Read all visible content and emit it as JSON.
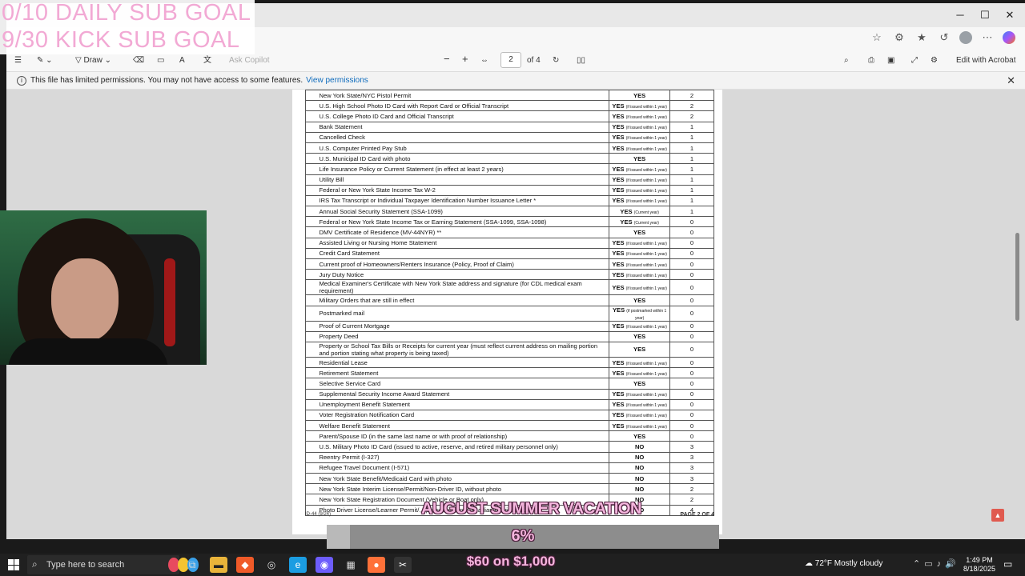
{
  "stream_goals": {
    "daily_sub_goal": "0/10 DAILY SUB GOAL",
    "kick_sub_goal": "9/30 KICK SUB GOAL"
  },
  "window_controls": {
    "minimize": "─",
    "maximize": "☐",
    "close": "✕"
  },
  "pdf_toolbar": {
    "draw_label": "Draw",
    "ask_copilot": "Ask Copilot",
    "zoom_out": "−",
    "zoom_in": "+",
    "current_page": "2",
    "page_total": "of 4",
    "edit_with_acrobat": "Edit with Acrobat"
  },
  "infobar": {
    "message": "This file has limited permissions. You may not have access to some features.",
    "link": "View permissions"
  },
  "document": {
    "rows": [
      {
        "name": "New York State/NYC Pistol Permit",
        "accept": "YES",
        "note": "",
        "points": "2"
      },
      {
        "name": "U.S. High School Photo ID Card with Report Card or Official Transcript",
        "accept": "YES",
        "note": "(if issued within 1 year)",
        "points": "2"
      },
      {
        "name": "U.S. College Photo ID Card and Official Transcript",
        "accept": "YES",
        "note": "(if issued within 1 year)",
        "points": "2"
      },
      {
        "name": "Bank Statement",
        "accept": "YES",
        "note": "(if issued within 1 year)",
        "points": "1"
      },
      {
        "name": "Cancelled Check",
        "accept": "YES",
        "note": "(if issued within 1 year)",
        "points": "1"
      },
      {
        "name": "U.S. Computer Printed Pay Stub",
        "accept": "YES",
        "note": "(if issued within 1 year)",
        "points": "1"
      },
      {
        "name": "U.S. Municipal ID Card with photo",
        "accept": "YES",
        "note": "",
        "points": "1"
      },
      {
        "name": "Life Insurance Policy or Current Statement (in effect at least 2 years)",
        "accept": "YES",
        "note": "(if issued within 1 year)",
        "points": "1"
      },
      {
        "name": "Utility Bill",
        "accept": "YES",
        "note": "(if issued within 1 year)",
        "points": "1"
      },
      {
        "name": "Federal or New York State Income Tax W-2",
        "accept": "YES",
        "note": "(if issued within 1 year)",
        "points": "1"
      },
      {
        "name": "IRS Tax Transcript or Individual Taxpayer Identification Number Issuance Letter *",
        "accept": "YES",
        "note": "(if issued within 1 year)",
        "points": "1"
      },
      {
        "name": "Annual Social Security Statement (SSA-1099)",
        "accept": "YES",
        "note": "(Current year)",
        "points": "1"
      },
      {
        "name": "Federal or New York State Income Tax or Earning Statement (SSA-1099, SSA-1098)",
        "accept": "YES",
        "note": "(Current year)",
        "points": "0"
      },
      {
        "name": "DMV Certificate of Residence (MV-44NYR) **",
        "accept": "YES",
        "note": "",
        "points": "0"
      },
      {
        "name": "Assisted Living or Nursing Home Statement",
        "accept": "YES",
        "note": "(if issued within 1 year)",
        "points": "0"
      },
      {
        "name": "Credit Card Statement",
        "accept": "YES",
        "note": "(if issued within 1 year)",
        "points": "0"
      },
      {
        "name": "Current proof of Homeowners/Renters Insurance (Policy, Proof of Claim)",
        "accept": "YES",
        "note": "(if issued within 1 year)",
        "points": "0"
      },
      {
        "name": "Jury Duty Notice",
        "accept": "YES",
        "note": "(if issued within 1 year)",
        "points": "0"
      },
      {
        "name": "Medical Examiner's Certificate with New York State address and signature (for CDL medical exam requirement)",
        "accept": "YES",
        "note": "(if issued within 1 year)",
        "points": "0"
      },
      {
        "name": "Military Orders that are still in effect",
        "accept": "YES",
        "note": "",
        "points": "0"
      },
      {
        "name": "Postmarked mail",
        "accept": "YES",
        "note": "(if postmarked within 1 year)",
        "points": "0"
      },
      {
        "name": "Proof of Current Mortgage",
        "accept": "YES",
        "note": "(if issued within 1 year)",
        "points": "0"
      },
      {
        "name": "Property Deed",
        "accept": "YES",
        "note": "",
        "points": "0"
      },
      {
        "name": "Property or School Tax Bills or Receipts for current year (must reflect current address on mailing portion and portion stating what property is being taxed)",
        "accept": "YES",
        "note": "",
        "points": "0"
      },
      {
        "name": "Residential Lease",
        "accept": "YES",
        "note": "(if issued within 1 year)",
        "points": "0"
      },
      {
        "name": "Retirement Statement",
        "accept": "YES",
        "note": "(if issued within 1 year)",
        "points": "0"
      },
      {
        "name": "Selective Service Card",
        "accept": "YES",
        "note": "",
        "points": "0"
      },
      {
        "name": "Supplemental Security Income Award Statement",
        "accept": "YES",
        "note": "(if issued within 1 year)",
        "points": "0"
      },
      {
        "name": "Unemployment Benefit Statement",
        "accept": "YES",
        "note": "(if issued within 1 year)",
        "points": "0"
      },
      {
        "name": "Voter Registration Notification Card",
        "accept": "YES",
        "note": "(if issued within 1 year)",
        "points": "0"
      },
      {
        "name": "Welfare Benefit Statement",
        "accept": "YES",
        "note": "(if issued within 1 year)",
        "points": "0"
      },
      {
        "name": "Parent/Spouse ID (in the same last name or with proof of relationship)",
        "accept": "YES",
        "note": "",
        "points": "0"
      },
      {
        "name": "U.S. Military Photo ID Card (issued to active, reserve, and retired military personnel only)",
        "accept": "NO",
        "note": "",
        "points": "3"
      },
      {
        "name": "Reentry Permit (I-327)",
        "accept": "NO",
        "note": "",
        "points": "3"
      },
      {
        "name": "Refugee Travel Document (I-571)",
        "accept": "NO",
        "note": "",
        "points": "3"
      },
      {
        "name": "New York State Benefit/Medicaid Card with photo",
        "accept": "NO",
        "note": "",
        "points": "3"
      },
      {
        "name": "New York State Interim License/Permit/Non-Driver ID, without photo",
        "accept": "NO",
        "note": "",
        "points": "2"
      },
      {
        "name": "New York State Registration Document (Vehicle or Boat only)",
        "accept": "NO",
        "note": "",
        "points": "2"
      },
      {
        "name": "Photo Driver License/Learner Permit/... possession, or Canadian province or...",
        "accept": "NO",
        "note": "",
        "points": "4"
      }
    ],
    "form_id": "ID-44 (9/24)",
    "page_label": "PAGE 2 OF 4"
  },
  "overlay": {
    "banner": "AUGUST SUMMER VACATION",
    "goal_percent": "6%",
    "goal_progress": 0.06,
    "goal_amount": "$60 on $1,000"
  },
  "taskbar": {
    "search_placeholder": "Type here to search",
    "weather": "72°F  Mostly cloudy",
    "time": "1:49 PM",
    "date": "8/18/2025"
  }
}
